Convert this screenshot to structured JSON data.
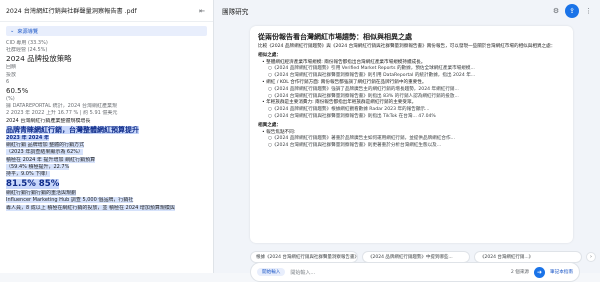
{
  "source": {
    "title": "2024 台灣網紅行銷與社群聲量洞察報告書 .pdf",
    "guide_label": "來源導覽",
    "lines": [
      "CID 專用 (33.3%)",
      "社群經營 (24.5%)",
      "2024 品牌投放策略",
      "回饋",
      "投放",
      "6",
      "60.5%",
      "(%)",
      "據 DATAREPORTAL 統計，2024 台灣網紅產業規",
      "2 2023 年 2022 上升 16.77 % | 約 5.91 億美元",
      "2024 台灣網紅行銷產業整體規模增長",
      "品牌青睞網紅行銷，台灣整體網紅預算提升",
      "2023 年 2024 年",
      "網紅行銷 品牌增加 整體的行銷方式",
      "（2023 年調查結果顯示為 62%）",
      "積極在 2024 年 提升增加 網紅行銷預算",
      "（59.4% 積極提升，22.7%",
      "持平，9.0% 下降）",
      "81.5% 85%",
      "網紅行銷行銷行銷的重活與規劃",
      "Influencer Marketing Hub 調查 5,000 個品牌，行銷社",
      "專人員，8 成以上 積極在網紅行銷的投放，並 積極在 2024 增加預算規模與"
    ]
  },
  "chat": {
    "title": "團隊研究",
    "card_title": "從兩份報告看台灣網紅市場趨勢：相似與相異之處",
    "intro": "比較《2024 品牌網紅行銷趨勢》與《2024 台灣網紅行銷與社群聲量洞察報告書》兩份報告，可以發現一些關於台灣網紅市場的相似與相異之處：",
    "s1": "相似之處：",
    "s1_items": [
      "• 整體網紅經濟產業市場規模: 兩份報告都指出台灣網紅產業市場規模持續成長。",
      "  ○《2024 品牌網紅行銷趨勢》引用 Verified Market Reports 的數據，預估全球網紅產業市場規模...",
      "  ○《2024 台灣網紅行銷與社群聲量洞察報告書》則引用 DataReportal 的統計數據，指出 2024 年...",
      "• 網紅 / KOL 合作行銷方面: 兩份報告都強調了網紅行銷在品牌行銷中的重要性。",
      "  ○《2024 品牌網紅行銷趨勢》強調了品牌廣告主的網紅行銷的增長趨勢，2024 年網紅行銷...",
      "  ○《2024 台灣網紅行銷與社群聲量洞察報告書》則指出 83% 的行銷人認為網紅行銷的投放...",
      "• 年輕族群是主要消費力: 兩份報告都指出年輕族群是網紅行銷的主要受眾。",
      "  ○《2024 品牌網紅行銷趨勢》根據網紅觀看數據 Radar 2023 年的報告顯示...",
      "  ○《2024 台灣網紅行銷與社群聲量洞察報告書》則指出 TikTok 在台灣... 47.04%"
    ],
    "s2": "相異之處：",
    "s2_items": [
      "• 報告焦點不同:",
      "  ○《2024 品牌網紅行銷趨勢》著重於品牌廣告主如何運用網紅行銷，並提供品牌網紅合作...",
      "  ○《2024 台灣網紅行銷與社群聲量洞察報告書》則更著重於分析台灣網紅生態以及..."
    ],
    "suggestions": [
      "根據《2024 台灣網紅行銷與社群聲量洞察報告書》中的數據，哪些社群媒體平台的網紅在台灣最具影響力?",
      "《2024 品牌網紅行銷趨勢》中提到哪些...",
      "《2024 台灣網紅行銷...》"
    ],
    "pill_label": "開始輸入",
    "placeholder": "開始輸入...",
    "source_count": "2 個來源",
    "notes_label": "筆記本指南"
  }
}
